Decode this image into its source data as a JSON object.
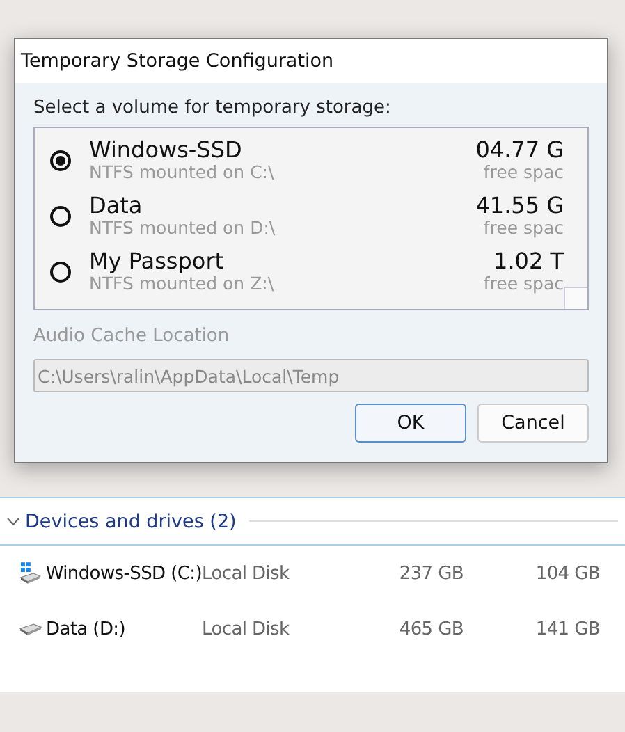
{
  "dialog": {
    "title": "Temporary Storage Configuration",
    "prompt": "Select a volume for temporary storage:",
    "volumes": [
      {
        "name": "Windows-SSD",
        "mount": "NTFS mounted on C:\\",
        "size": "04.77 G",
        "free_label": "free spac",
        "selected": true
      },
      {
        "name": "Data",
        "mount": "NTFS mounted on D:\\",
        "size": "41.55 G",
        "free_label": "free spac",
        "selected": false
      },
      {
        "name": "My Passport",
        "mount": "NTFS mounted on Z:\\",
        "size": "1.02 T",
        "free_label": "free spac",
        "selected": false
      }
    ],
    "cache_label": "Audio Cache Location",
    "cache_path": "C:\\Users\\ralin\\AppData\\Local\\Temp",
    "cache_disabled": true,
    "buttons": [
      {
        "label": "OK",
        "kind": "default"
      },
      {
        "label": "Cancel",
        "kind": "normal"
      }
    ]
  },
  "explorer": {
    "group": {
      "title": "Devices and drives (2)",
      "expanded": true
    },
    "drives": [
      {
        "name": "Windows-SSD (C:)",
        "type": "Local Disk",
        "total": "237 GB",
        "free": "104 GB",
        "kind": "system"
      },
      {
        "name": "Data (D:)",
        "type": "Local Disk",
        "total": "465 GB",
        "free": "141 GB",
        "kind": "disk"
      }
    ]
  }
}
